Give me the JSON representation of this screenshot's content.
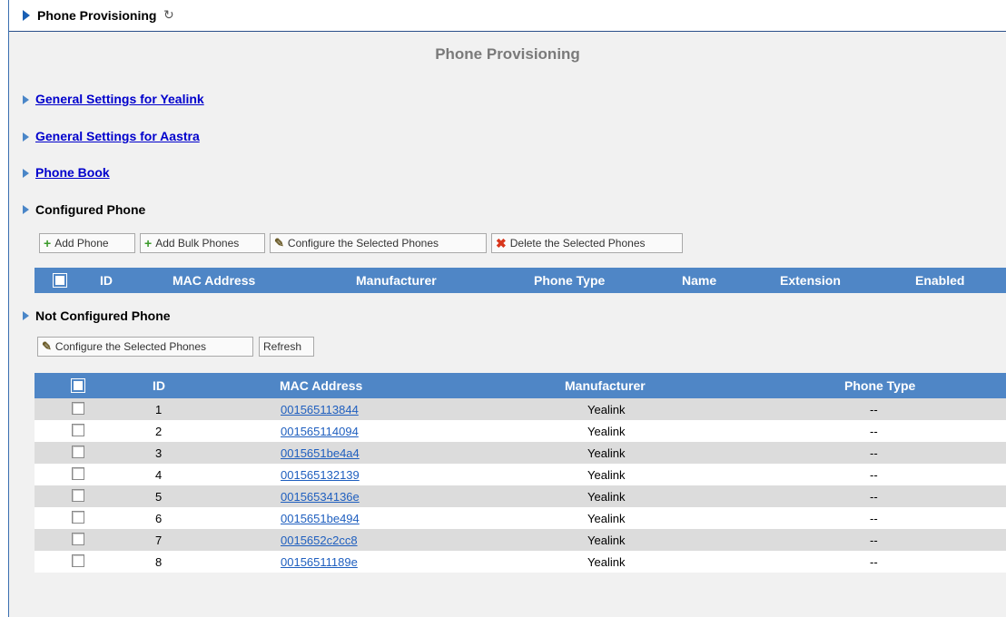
{
  "header": {
    "title": "Phone Provisioning",
    "refresh_icon": "refresh-icon"
  },
  "page": {
    "heading": "Phone Provisioning"
  },
  "sections": {
    "yealink": "General Settings for Yealink",
    "aastra": "General Settings for Aastra",
    "phonebook": "Phone Book",
    "configured": "Configured Phone",
    "not_configured": "Not Configured Phone"
  },
  "configured_toolbar": {
    "add_phone": "Add Phone",
    "add_bulk": "Add Bulk Phones",
    "configure_selected": "Configure the Selected Phones",
    "delete_selected": "Delete the Selected Phones"
  },
  "configured_table": {
    "columns": [
      "ID",
      "MAC Address",
      "Manufacturer",
      "Phone Type",
      "Name",
      "Extension",
      "Enabled"
    ]
  },
  "not_configured_toolbar": {
    "configure_selected": "Configure the Selected Phones",
    "refresh": "Refresh"
  },
  "not_configured_table": {
    "columns": [
      "ID",
      "MAC Address",
      "Manufacturer",
      "Phone Type"
    ],
    "rows": [
      {
        "id": "1",
        "mac": "001565113844",
        "manufacturer": "Yealink",
        "phone_type": "--"
      },
      {
        "id": "2",
        "mac": "001565114094",
        "manufacturer": "Yealink",
        "phone_type": "--"
      },
      {
        "id": "3",
        "mac": "0015651be4a4",
        "manufacturer": "Yealink",
        "phone_type": "--"
      },
      {
        "id": "4",
        "mac": "001565132139",
        "manufacturer": "Yealink",
        "phone_type": "--"
      },
      {
        "id": "5",
        "mac": "00156534136e",
        "manufacturer": "Yealink",
        "phone_type": "--"
      },
      {
        "id": "6",
        "mac": "0015651be494",
        "manufacturer": "Yealink",
        "phone_type": "--"
      },
      {
        "id": "7",
        "mac": "0015652c2cc8",
        "manufacturer": "Yealink",
        "phone_type": "--"
      },
      {
        "id": "8",
        "mac": "00156511189e",
        "manufacturer": "Yealink",
        "phone_type": "--"
      }
    ]
  },
  "colors": {
    "header_blue": "#4f86c6",
    "link": "#0000cc",
    "mac_link": "#1f5fbf",
    "row_alt": "#dcdcdc"
  }
}
